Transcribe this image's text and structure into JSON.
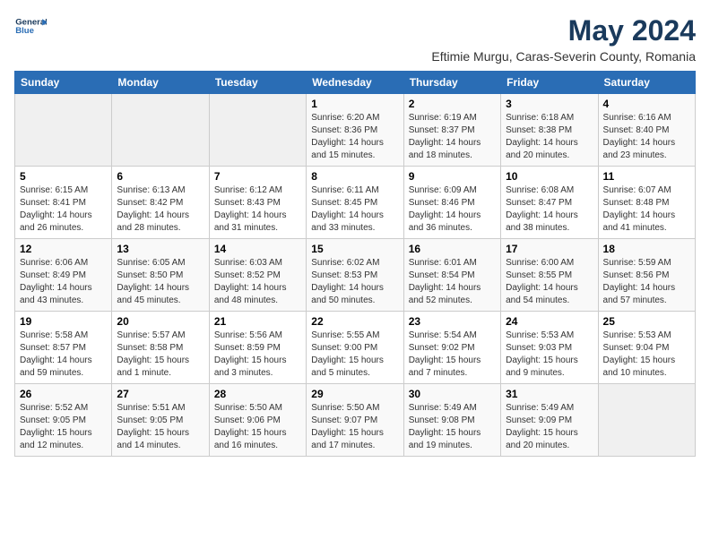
{
  "logo": {
    "line1": "General",
    "line2": "Blue"
  },
  "title": "May 2024",
  "subtitle": "Eftimie Murgu, Caras-Severin County, Romania",
  "weekdays": [
    "Sunday",
    "Monday",
    "Tuesday",
    "Wednesday",
    "Thursday",
    "Friday",
    "Saturday"
  ],
  "weeks": [
    [
      {
        "day": "",
        "info": ""
      },
      {
        "day": "",
        "info": ""
      },
      {
        "day": "",
        "info": ""
      },
      {
        "day": "1",
        "info": "Sunrise: 6:20 AM\nSunset: 8:36 PM\nDaylight: 14 hours\nand 15 minutes."
      },
      {
        "day": "2",
        "info": "Sunrise: 6:19 AM\nSunset: 8:37 PM\nDaylight: 14 hours\nand 18 minutes."
      },
      {
        "day": "3",
        "info": "Sunrise: 6:18 AM\nSunset: 8:38 PM\nDaylight: 14 hours\nand 20 minutes."
      },
      {
        "day": "4",
        "info": "Sunrise: 6:16 AM\nSunset: 8:40 PM\nDaylight: 14 hours\nand 23 minutes."
      }
    ],
    [
      {
        "day": "5",
        "info": "Sunrise: 6:15 AM\nSunset: 8:41 PM\nDaylight: 14 hours\nand 26 minutes."
      },
      {
        "day": "6",
        "info": "Sunrise: 6:13 AM\nSunset: 8:42 PM\nDaylight: 14 hours\nand 28 minutes."
      },
      {
        "day": "7",
        "info": "Sunrise: 6:12 AM\nSunset: 8:43 PM\nDaylight: 14 hours\nand 31 minutes."
      },
      {
        "day": "8",
        "info": "Sunrise: 6:11 AM\nSunset: 8:45 PM\nDaylight: 14 hours\nand 33 minutes."
      },
      {
        "day": "9",
        "info": "Sunrise: 6:09 AM\nSunset: 8:46 PM\nDaylight: 14 hours\nand 36 minutes."
      },
      {
        "day": "10",
        "info": "Sunrise: 6:08 AM\nSunset: 8:47 PM\nDaylight: 14 hours\nand 38 minutes."
      },
      {
        "day": "11",
        "info": "Sunrise: 6:07 AM\nSunset: 8:48 PM\nDaylight: 14 hours\nand 41 minutes."
      }
    ],
    [
      {
        "day": "12",
        "info": "Sunrise: 6:06 AM\nSunset: 8:49 PM\nDaylight: 14 hours\nand 43 minutes."
      },
      {
        "day": "13",
        "info": "Sunrise: 6:05 AM\nSunset: 8:50 PM\nDaylight: 14 hours\nand 45 minutes."
      },
      {
        "day": "14",
        "info": "Sunrise: 6:03 AM\nSunset: 8:52 PM\nDaylight: 14 hours\nand 48 minutes."
      },
      {
        "day": "15",
        "info": "Sunrise: 6:02 AM\nSunset: 8:53 PM\nDaylight: 14 hours\nand 50 minutes."
      },
      {
        "day": "16",
        "info": "Sunrise: 6:01 AM\nSunset: 8:54 PM\nDaylight: 14 hours\nand 52 minutes."
      },
      {
        "day": "17",
        "info": "Sunrise: 6:00 AM\nSunset: 8:55 PM\nDaylight: 14 hours\nand 54 minutes."
      },
      {
        "day": "18",
        "info": "Sunrise: 5:59 AM\nSunset: 8:56 PM\nDaylight: 14 hours\nand 57 minutes."
      }
    ],
    [
      {
        "day": "19",
        "info": "Sunrise: 5:58 AM\nSunset: 8:57 PM\nDaylight: 14 hours\nand 59 minutes."
      },
      {
        "day": "20",
        "info": "Sunrise: 5:57 AM\nSunset: 8:58 PM\nDaylight: 15 hours\nand 1 minute."
      },
      {
        "day": "21",
        "info": "Sunrise: 5:56 AM\nSunset: 8:59 PM\nDaylight: 15 hours\nand 3 minutes."
      },
      {
        "day": "22",
        "info": "Sunrise: 5:55 AM\nSunset: 9:00 PM\nDaylight: 15 hours\nand 5 minutes."
      },
      {
        "day": "23",
        "info": "Sunrise: 5:54 AM\nSunset: 9:02 PM\nDaylight: 15 hours\nand 7 minutes."
      },
      {
        "day": "24",
        "info": "Sunrise: 5:53 AM\nSunset: 9:03 PM\nDaylight: 15 hours\nand 9 minutes."
      },
      {
        "day": "25",
        "info": "Sunrise: 5:53 AM\nSunset: 9:04 PM\nDaylight: 15 hours\nand 10 minutes."
      }
    ],
    [
      {
        "day": "26",
        "info": "Sunrise: 5:52 AM\nSunset: 9:05 PM\nDaylight: 15 hours\nand 12 minutes."
      },
      {
        "day": "27",
        "info": "Sunrise: 5:51 AM\nSunset: 9:05 PM\nDaylight: 15 hours\nand 14 minutes."
      },
      {
        "day": "28",
        "info": "Sunrise: 5:50 AM\nSunset: 9:06 PM\nDaylight: 15 hours\nand 16 minutes."
      },
      {
        "day": "29",
        "info": "Sunrise: 5:50 AM\nSunset: 9:07 PM\nDaylight: 15 hours\nand 17 minutes."
      },
      {
        "day": "30",
        "info": "Sunrise: 5:49 AM\nSunset: 9:08 PM\nDaylight: 15 hours\nand 19 minutes."
      },
      {
        "day": "31",
        "info": "Sunrise: 5:49 AM\nSunset: 9:09 PM\nDaylight: 15 hours\nand 20 minutes."
      },
      {
        "day": "",
        "info": ""
      }
    ]
  ]
}
